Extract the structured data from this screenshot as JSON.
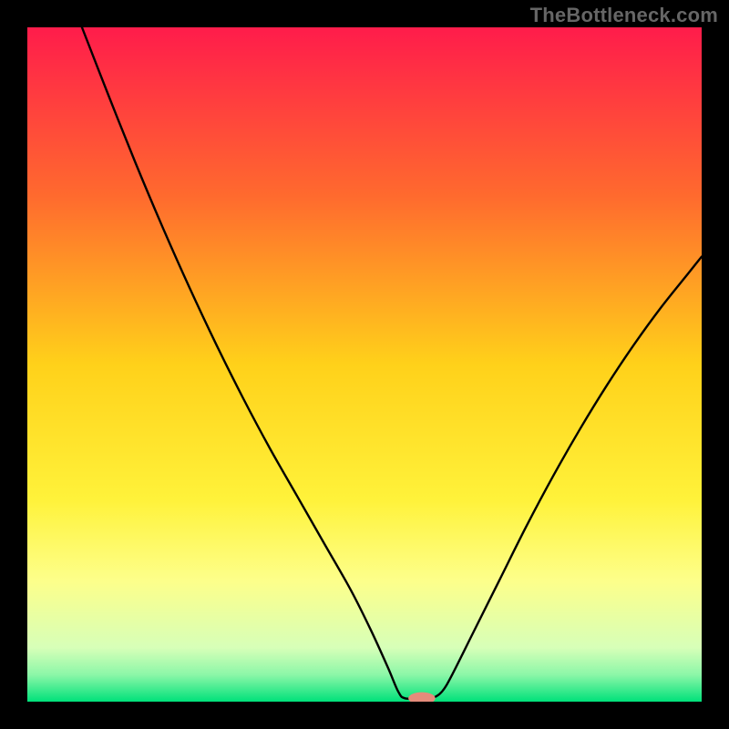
{
  "watermark": "TheBottleneck.com",
  "chart_data": {
    "type": "line",
    "title": "",
    "xlabel": "",
    "ylabel": "",
    "xlim": [
      0,
      100
    ],
    "ylim": [
      0,
      100
    ],
    "background_gradient": {
      "stops": [
        {
          "offset": 0.0,
          "color": "#ff1c4b"
        },
        {
          "offset": 0.25,
          "color": "#ff6a2e"
        },
        {
          "offset": 0.5,
          "color": "#ffd11a"
        },
        {
          "offset": 0.7,
          "color": "#fff23a"
        },
        {
          "offset": 0.82,
          "color": "#fdff8a"
        },
        {
          "offset": 0.92,
          "color": "#d7ffb8"
        },
        {
          "offset": 0.96,
          "color": "#8cf7a8"
        },
        {
          "offset": 1.0,
          "color": "#00e17a"
        }
      ]
    },
    "series": [
      {
        "name": "bottleneck-curve",
        "color": "#000000",
        "points": [
          {
            "x": 8.1,
            "y": 100.0
          },
          {
            "x": 12.0,
            "y": 90.0
          },
          {
            "x": 16.0,
            "y": 80.0
          },
          {
            "x": 20.0,
            "y": 70.5
          },
          {
            "x": 24.0,
            "y": 61.5
          },
          {
            "x": 28.0,
            "y": 53.0
          },
          {
            "x": 32.0,
            "y": 45.0
          },
          {
            "x": 36.0,
            "y": 37.5
          },
          {
            "x": 40.0,
            "y": 30.5
          },
          {
            "x": 44.0,
            "y": 23.5
          },
          {
            "x": 48.0,
            "y": 16.5
          },
          {
            "x": 51.0,
            "y": 10.5
          },
          {
            "x": 53.5,
            "y": 5.0
          },
          {
            "x": 55.0,
            "y": 1.5
          },
          {
            "x": 56.0,
            "y": 0.5
          },
          {
            "x": 58.5,
            "y": 0.5
          },
          {
            "x": 60.0,
            "y": 0.5
          },
          {
            "x": 61.5,
            "y": 1.5
          },
          {
            "x": 63.0,
            "y": 4.0
          },
          {
            "x": 66.0,
            "y": 10.0
          },
          {
            "x": 70.0,
            "y": 18.0
          },
          {
            "x": 74.0,
            "y": 26.0
          },
          {
            "x": 78.0,
            "y": 33.5
          },
          {
            "x": 82.0,
            "y": 40.5
          },
          {
            "x": 86.0,
            "y": 47.0
          },
          {
            "x": 90.0,
            "y": 53.0
          },
          {
            "x": 94.0,
            "y": 58.5
          },
          {
            "x": 98.0,
            "y": 63.5
          },
          {
            "x": 100.0,
            "y": 66.0
          }
        ]
      }
    ],
    "marker": {
      "name": "optimal-point",
      "x": 58.5,
      "y": 0.5,
      "color": "#e58b7b",
      "rx": 2.0,
      "ry": 0.9
    }
  }
}
